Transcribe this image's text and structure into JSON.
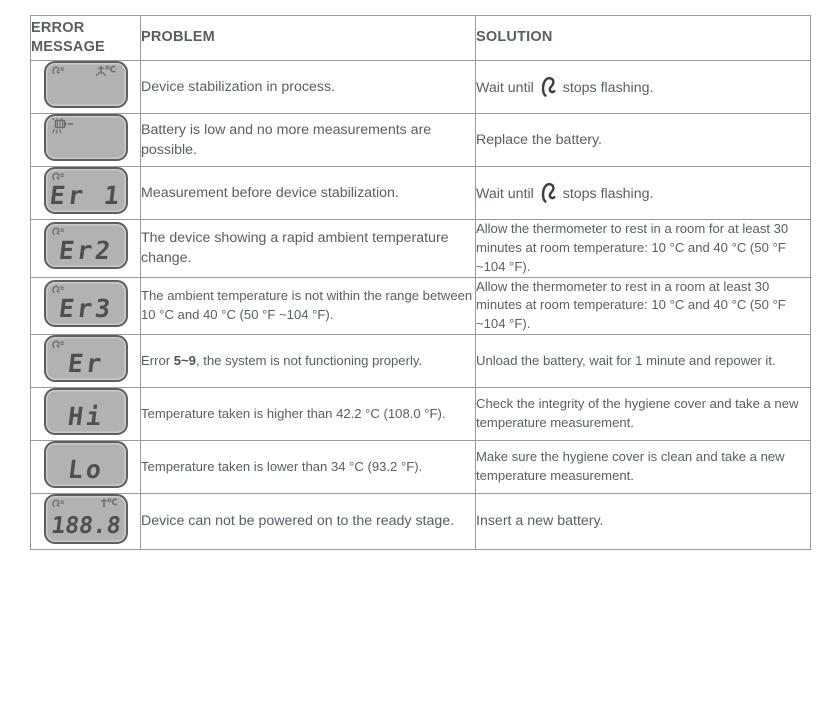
{
  "table": {
    "headers": {
      "error_message": "ERROR\nMESSAGE",
      "error_message_line1": "ERROR",
      "error_message_line2": "MESSAGE",
      "problem": "PROBLEM",
      "solution": "SOLUTION"
    },
    "colors": {
      "text": "#595e66",
      "border": "#9a9a9a",
      "lcd_face": "#b2b2b2",
      "lcd_bezel": "#5f5f5f",
      "lcd_segment": "#4f4f4f"
    },
    "rows": [
      {
        "display": "",
        "display_icons": [
          "ear-icon",
          "temperature-icon"
        ],
        "problem": "Device stabilization in process.",
        "solution_before": "Wait until",
        "solution_icon": "ear-icon",
        "solution_after": "stops flashing."
      },
      {
        "display": "",
        "display_icons": [
          "flashing-battery-icon"
        ],
        "problem": "Battery is low and no more measurements are possible.",
        "solution": "Replace the battery."
      },
      {
        "display": "Er 1",
        "display_icons": [
          "ear-icon"
        ],
        "problem": "Measurement before device stabilization.",
        "solution_before": "Wait until",
        "solution_icon": "ear-icon",
        "solution_after": "stops flashing."
      },
      {
        "display": "Er2",
        "display_icons": [
          "ear-icon"
        ],
        "problem": "The device showing a rapid ambient temperature change.",
        "solution": "Allow the thermometer to rest in a room for at least 30 minutes at room temperature: 10 °C and 40 °C (50 °F ~104 °F)."
      },
      {
        "display": "Er3",
        "display_icons": [
          "ear-icon"
        ],
        "problem": "The ambient temperature is not within the range between 10 °C and 40 °C (50 °F ~104 °F).",
        "solution": "Allow the thermometer to rest in a room at least 30 minutes at room temperature: 10 °C and 40 °C (50 °F ~104 °F)."
      },
      {
        "display": "Er",
        "display_icons": [
          "ear-icon"
        ],
        "problem_before": "Error",
        "problem_bold": "5~9",
        "problem_after": ", the system is not functioning properly.",
        "solution": "Unload the battery, wait for 1 minute and repower it."
      },
      {
        "display": "Hi",
        "display_icons": [],
        "problem": "Temperature taken is higher than 42.2 °C (108.0 °F).",
        "solution": "Check the integrity of the hygiene cover and take a new temperature measurement."
      },
      {
        "display": "Lo",
        "display_icons": [],
        "problem": "Temperature taken is lower than 34 °C (93.2 °F).",
        "solution": "Make sure the hygiene cover is clean and take a new temperature measurement."
      },
      {
        "display": "188.8",
        "display_icons": [
          "ear-icon",
          "temperature-icon"
        ],
        "problem": "Device can not be powered on to the ready stage.",
        "solution": "Insert a new battery."
      }
    ]
  }
}
